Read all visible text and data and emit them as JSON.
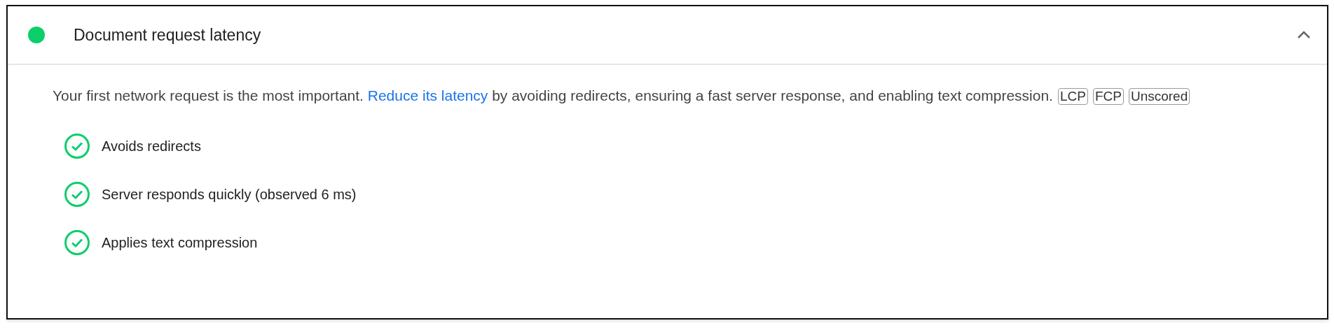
{
  "audit": {
    "title": "Document request latency",
    "color": "#0cce6b",
    "expanded": true,
    "description": {
      "before": "Your first network request is the most important. ",
      "link": "Reduce its latency",
      "after": " by avoiding redirects, ensuring a fast server response, and enabling text compression."
    },
    "tags": [
      "LCP",
      "FCP",
      "Unscored"
    ],
    "checks": [
      {
        "label": "Avoids redirects",
        "passed": true
      },
      {
        "label": "Server responds quickly (observed 6 ms)",
        "passed": true
      },
      {
        "label": "Applies text compression",
        "passed": true
      }
    ]
  }
}
